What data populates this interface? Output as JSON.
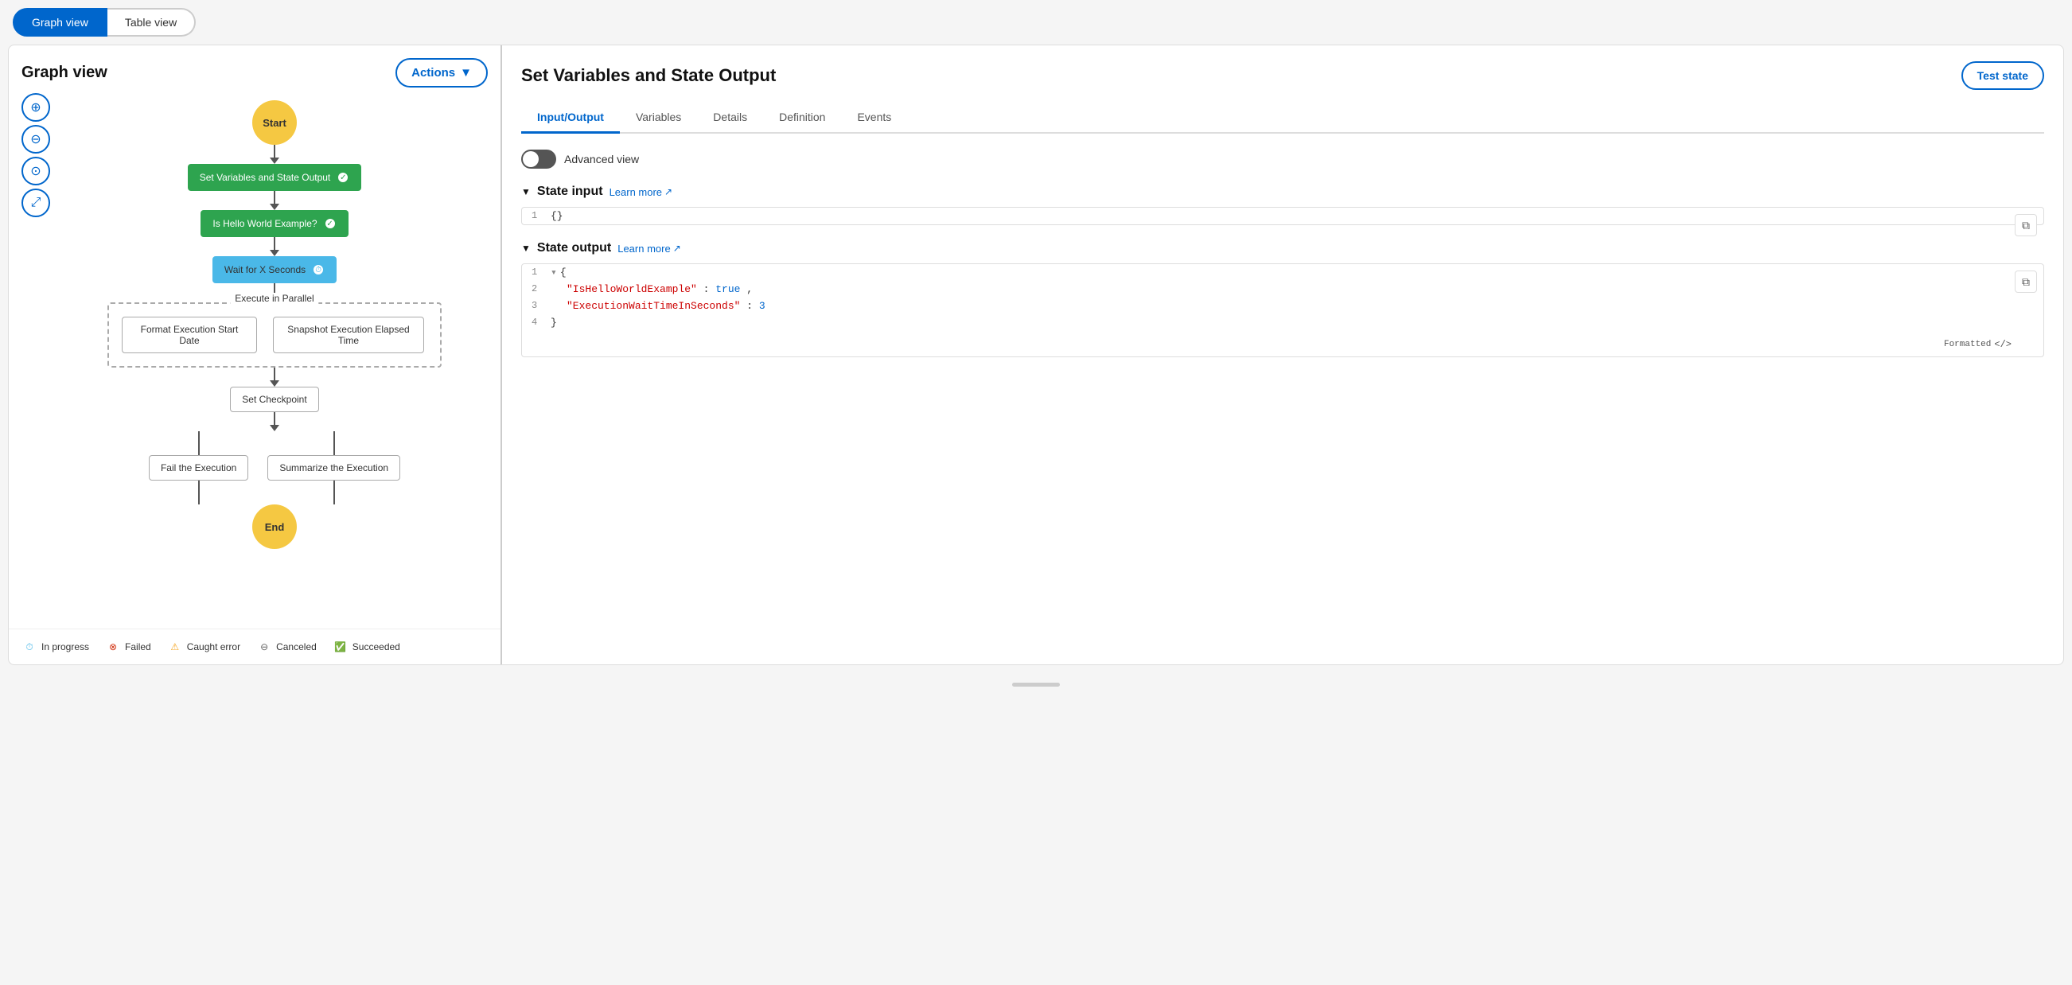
{
  "topbar": {
    "graph_view_label": "Graph view",
    "table_view_label": "Table view"
  },
  "left_panel": {
    "title": "Graph view",
    "actions_label": "Actions",
    "zoom_in_label": "+",
    "zoom_out_label": "−",
    "center_label": "⊙",
    "fit_label": "⤢",
    "nodes": {
      "start": "Start",
      "set_variables": "Set Variables and State Output",
      "is_hello_world": "Is Hello World Example?",
      "wait_for_seconds": "Wait for X Seconds",
      "execute_parallel": "Execute in Parallel",
      "format_start_date": "Format Execution Start Date",
      "snapshot_elapsed": "Snapshot Execution Elapsed Time",
      "set_checkpoint": "Set Checkpoint",
      "fail_execution": "Fail the Execution",
      "summarize_execution": "Summarize the Execution",
      "end": "End"
    },
    "legend": [
      {
        "id": "in_progress",
        "label": "In progress",
        "color": "#4ab8e8",
        "type": "clock"
      },
      {
        "id": "failed",
        "label": "Failed",
        "color": "#d13212",
        "type": "x-circle"
      },
      {
        "id": "caught_error",
        "label": "Caught error",
        "color": "#f5a623",
        "type": "warning"
      },
      {
        "id": "canceled",
        "label": "Canceled",
        "color": "#666",
        "type": "minus-circle"
      },
      {
        "id": "succeeded",
        "label": "Succeeded",
        "color": "#2ea44f",
        "type": "check-circle"
      }
    ]
  },
  "right_panel": {
    "title": "Set Variables and State Output",
    "test_state_label": "Test state",
    "tabs": [
      {
        "id": "input_output",
        "label": "Input/Output",
        "active": true
      },
      {
        "id": "variables",
        "label": "Variables",
        "active": false
      },
      {
        "id": "details",
        "label": "Details",
        "active": false
      },
      {
        "id": "definition",
        "label": "Definition",
        "active": false
      },
      {
        "id": "events",
        "label": "Events",
        "active": false
      }
    ],
    "advanced_view_label": "Advanced view",
    "state_input": {
      "section_label": "State input",
      "learn_more_label": "Learn more",
      "content": "{}",
      "line_num": "1"
    },
    "state_output": {
      "section_label": "State output",
      "learn_more_label": "Learn more",
      "formatted_label": "Formatted",
      "lines": [
        {
          "num": "1",
          "content": "{",
          "type": "brace"
        },
        {
          "num": "2",
          "key": "\"IsHelloWorldExample\"",
          "colon": ":",
          "value": "true",
          "val_type": "bool"
        },
        {
          "num": "3",
          "key": "\"ExecutionWaitTimeInSeconds\"",
          "colon": ":",
          "value": "3",
          "val_type": "num"
        },
        {
          "num": "4",
          "content": "}",
          "type": "brace"
        }
      ]
    }
  }
}
